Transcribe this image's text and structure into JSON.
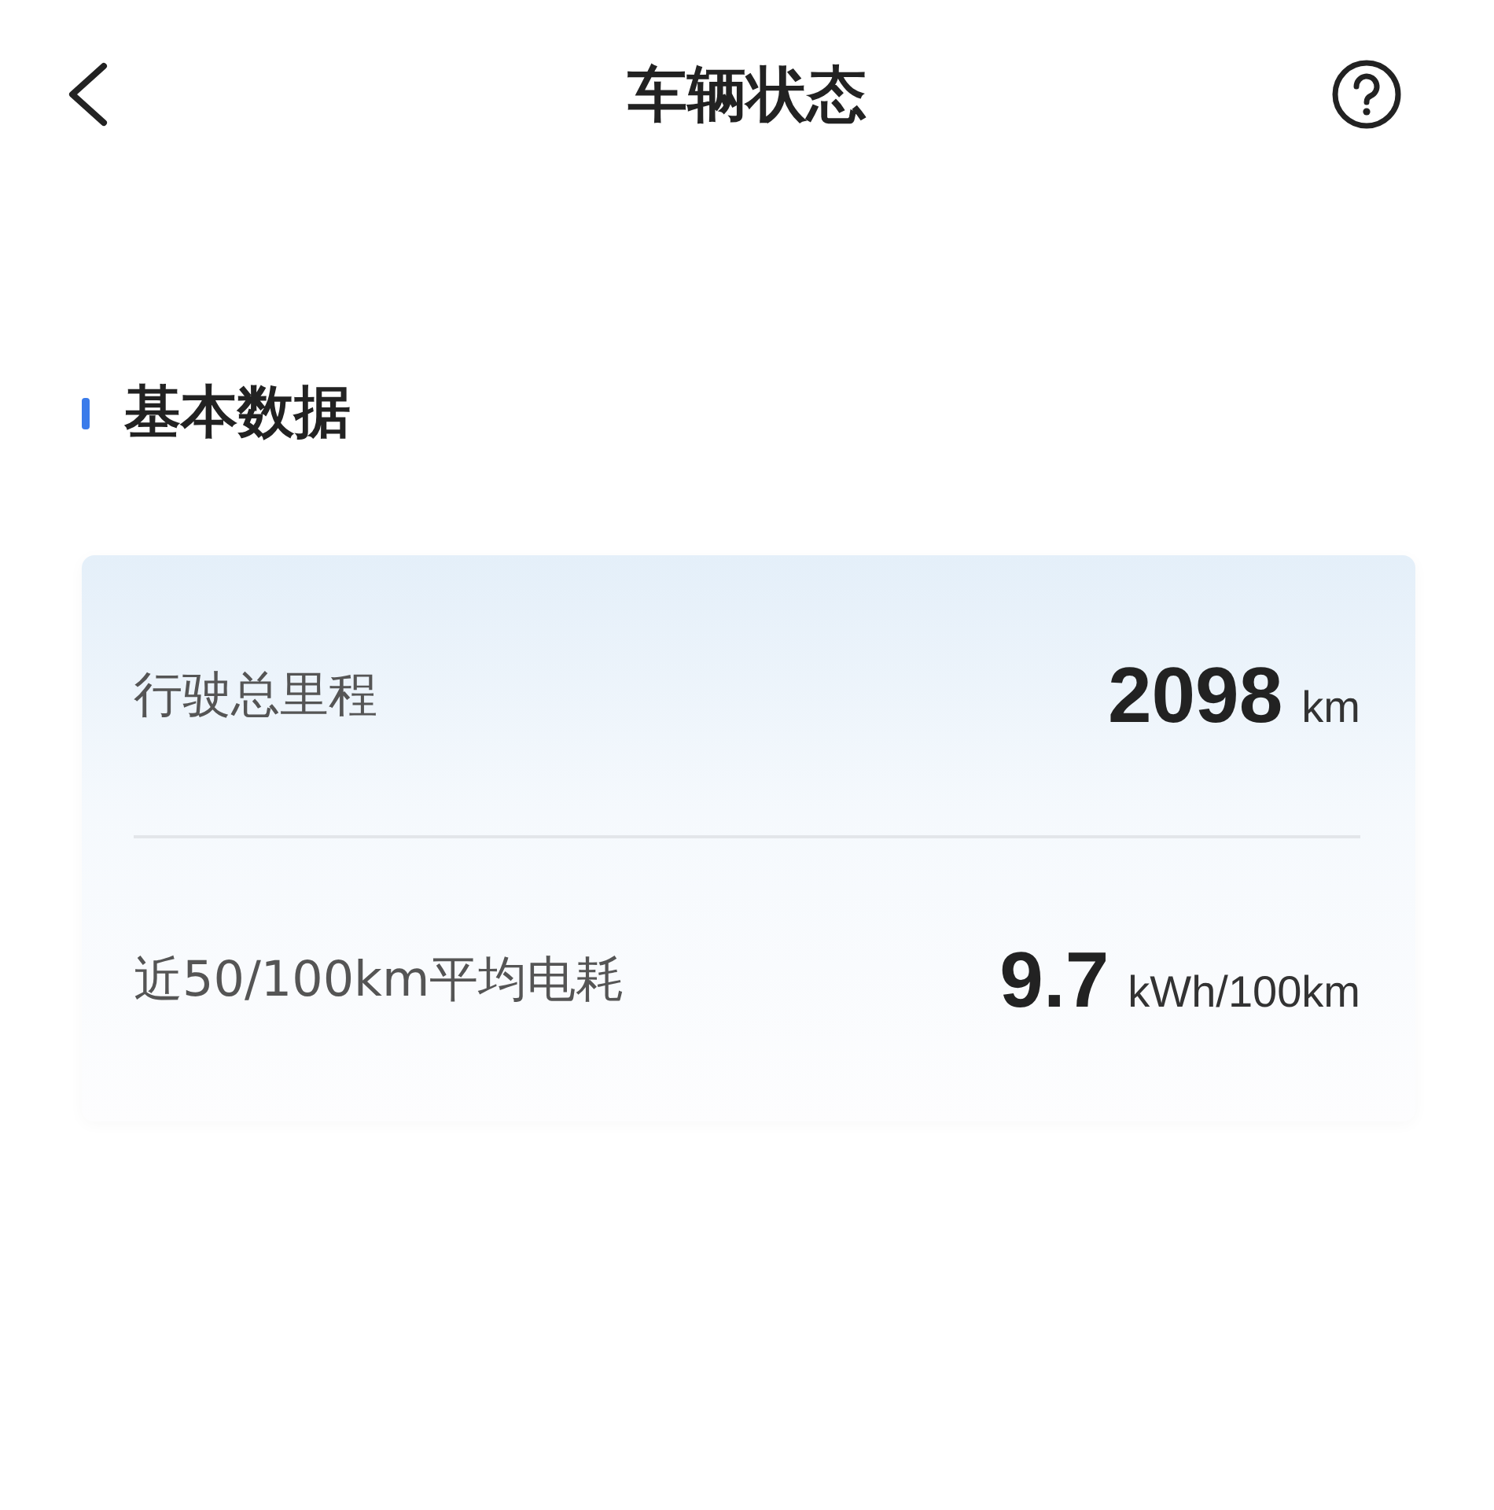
{
  "header": {
    "title": "车辆状态"
  },
  "section": {
    "title": "基本数据"
  },
  "stats": [
    {
      "label": "行驶总里程",
      "value": "2098",
      "unit": "km"
    },
    {
      "label": "近50/100km平均电耗",
      "value": "9.7",
      "unit": "kWh/100km"
    }
  ]
}
